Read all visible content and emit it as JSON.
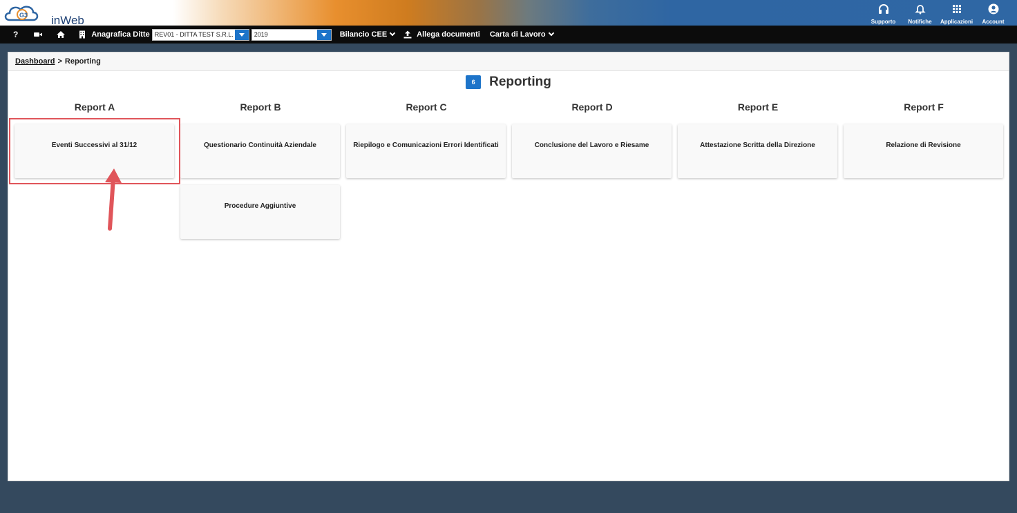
{
  "header": {
    "logo_text": "inWeb",
    "icons": [
      {
        "name": "headset-icon",
        "label": "Supporto"
      },
      {
        "name": "bell-icon",
        "label": "Notifiche"
      },
      {
        "name": "grid-icon",
        "label": "Applicazioni"
      },
      {
        "name": "user-icon",
        "label": "Account"
      }
    ]
  },
  "navbar": {
    "help_label": "?",
    "anagrafica_label": "Anagrafica Ditte",
    "company_select": "REV01 - DITTA TEST S.R.L.",
    "year_select": "2019",
    "bilancio_label": "Bilancio CEE",
    "allega_label": "Allega documenti",
    "carta_label": "Carta di Lavoro"
  },
  "breadcrumb": {
    "dashboard": "Dashboard",
    "separator": ">",
    "current": "Reporting"
  },
  "page": {
    "badge": "6",
    "title": "Reporting"
  },
  "columns": [
    {
      "header": "Report A",
      "cards": [
        "Eventi Successivi al 31/12"
      ]
    },
    {
      "header": "Report B",
      "cards": [
        "Questionario Continuità Aziendale",
        "Procedure Aggiuntive"
      ]
    },
    {
      "header": "Report C",
      "cards": [
        "Riepilogo e Comunicazioni Errori Identificati"
      ]
    },
    {
      "header": "Report D",
      "cards": [
        "Conclusione del Lavoro e Riesame"
      ]
    },
    {
      "header": "Report E",
      "cards": [
        "Attestazione Scritta della Direzione"
      ]
    },
    {
      "header": "Report F",
      "cards": [
        "Relazione di Revisione"
      ]
    }
  ],
  "colors": {
    "accent": "#1d74c9",
    "highlight": "#e0555a",
    "navbar": "#0c0c0c",
    "background": "#34495e"
  }
}
